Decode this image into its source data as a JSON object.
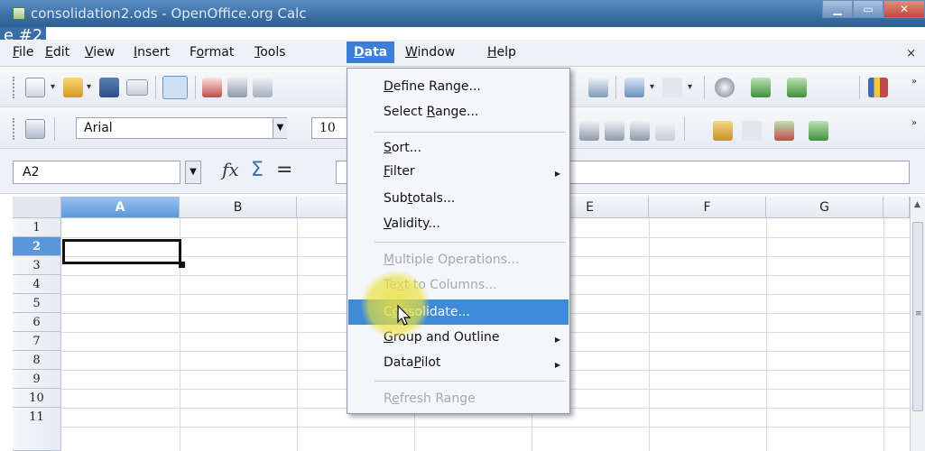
{
  "window": {
    "title": "consolidation2.ods - OpenOffice.org Calc",
    "overlay_tag": "e #2"
  },
  "menubar": {
    "items": [
      {
        "pre": "",
        "ul": "F",
        "post": "ile"
      },
      {
        "pre": "",
        "ul": "E",
        "post": "dit"
      },
      {
        "pre": "",
        "ul": "V",
        "post": "iew"
      },
      {
        "pre": "",
        "ul": "I",
        "post": "nsert"
      },
      {
        "pre": "F",
        "ul": "o",
        "post": "rmat"
      },
      {
        "pre": "",
        "ul": "T",
        "post": "ools"
      },
      {
        "pre": "",
        "ul": "D",
        "post": "ata"
      },
      {
        "pre": "",
        "ul": "W",
        "post": "indow"
      },
      {
        "pre": "",
        "ul": "H",
        "post": "elp"
      }
    ],
    "close_glyph": "×"
  },
  "formatting": {
    "font_name": "Arial",
    "font_size": "10"
  },
  "formula_bar": {
    "name_box": "A2",
    "fx_glyph": "fx",
    "sum_glyph": "Σ",
    "equals_glyph": "="
  },
  "sheet": {
    "columns": [
      "A",
      "B",
      "C",
      "D",
      "E",
      "F",
      "G"
    ],
    "selected_column": "A",
    "rows": [
      "1",
      "2",
      "3",
      "4",
      "5",
      "6",
      "7",
      "8",
      "9",
      "10",
      "11"
    ],
    "selected_row": "2",
    "active_cell": "A2"
  },
  "data_menu": {
    "items": [
      {
        "pre": "",
        "ul": "D",
        "post": "efine Range...",
        "enabled": true
      },
      {
        "pre": "Select ",
        "ul": "R",
        "post": "ange...",
        "enabled": true
      },
      {
        "pre": "",
        "ul": "S",
        "post": "ort...",
        "enabled": true
      },
      {
        "pre": "",
        "ul": "F",
        "post": "ilter",
        "enabled": true,
        "submenu": true
      },
      {
        "pre": "Sub",
        "ul": "t",
        "post": "otals...",
        "enabled": true
      },
      {
        "pre": "",
        "ul": "V",
        "post": "alidity...",
        "enabled": true
      },
      {
        "pre": "",
        "ul": "M",
        "post": "ultiple Operations...",
        "enabled": false
      },
      {
        "pre": "Te",
        "ul": "x",
        "post": "t to Columns...",
        "enabled": false
      },
      {
        "pre": "C",
        "ul": "o",
        "post": "nsolidate...",
        "enabled": true,
        "highlighted": true
      },
      {
        "pre": "",
        "ul": "G",
        "post": "roup and Outline",
        "enabled": true,
        "submenu": true
      },
      {
        "pre": "Data",
        "ul": "P",
        "post": "ilot",
        "enabled": true,
        "submenu": true
      },
      {
        "pre": "R",
        "ul": "e",
        "post": "fresh Range",
        "enabled": false
      }
    ]
  },
  "colors": {
    "menu_highlight": "#3d8ad9",
    "selected_header": "#5b97d9",
    "cursor_glow": "#ebe13c"
  }
}
